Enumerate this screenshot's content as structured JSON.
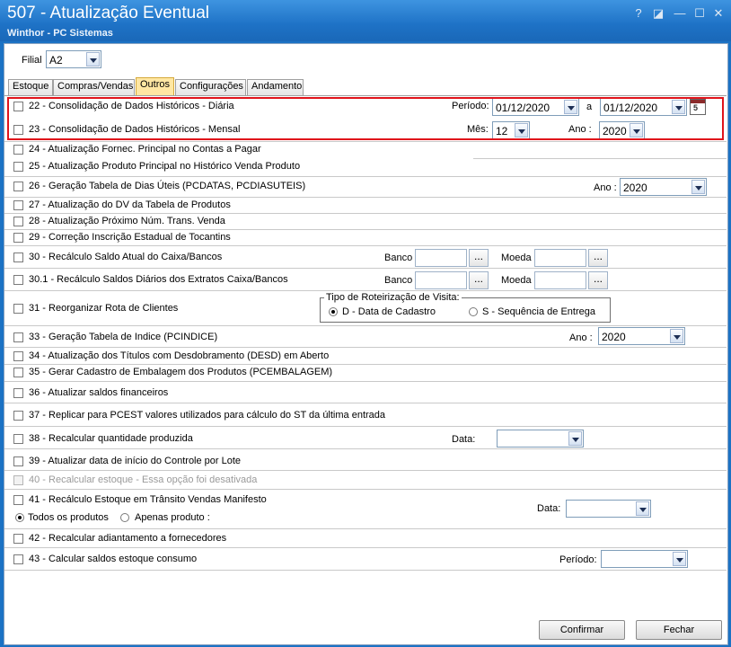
{
  "window": {
    "title": "507 - Atualização Eventual",
    "subtitle": "Winthor - PC Sistemas",
    "help_glyph": "?",
    "restore_glyph": "◪",
    "minimize_glyph": "—",
    "maximize_glyph": "☐",
    "close_glyph": "✕"
  },
  "filial": {
    "label": "Filial",
    "value": "A2"
  },
  "tabs": [
    {
      "label": "Estoque"
    },
    {
      "label": "Compras/Vendas"
    },
    {
      "label": "Outros",
      "active": true
    },
    {
      "label": "Configurações"
    },
    {
      "label": "Andamento"
    }
  ],
  "options": {
    "o22": {
      "label": "22 - Consolidação de Dados Históricos - Diária",
      "periodo_label": "Período:",
      "date_from": "01/12/2020",
      "a_label": "a",
      "date_to": "01/12/2020",
      "cal_digit": "5"
    },
    "o23": {
      "label": "23 - Consolidação de Dados Históricos - Mensal",
      "mes_label": "Mês:",
      "mes_value": "12",
      "ano_label": "Ano :",
      "ano_value": "2020"
    },
    "o24": {
      "label": "24 - Atualização Fornec. Principal no Contas a Pagar"
    },
    "o25": {
      "label": "25 - Atualização Produto Principal no Histórico Venda Produto"
    },
    "o26": {
      "label": "26 - Geração Tabela de Dias Úteis (PCDATAS, PCDIASUTEIS)",
      "ano_label": "Ano :",
      "ano_value": "2020"
    },
    "o27": {
      "label": "27 - Atualização do DV da Tabela de Produtos"
    },
    "o28": {
      "label": "28 - Atualização Próximo Núm. Trans. Venda"
    },
    "o29": {
      "label": "29 - Correção Inscrição Estadual de Tocantins"
    },
    "o30": {
      "label": "30 - Recálculo Saldo Atual do Caixa/Bancos",
      "banco_label": "Banco",
      "moeda_label": "Moeda",
      "dots": "..."
    },
    "o301": {
      "label": "30.1 - Recálculo Saldos Diários dos Extratos Caixa/Bancos",
      "banco_label": "Banco",
      "moeda_label": "Moeda",
      "dots": "..."
    },
    "o31": {
      "label": "31 - Reorganizar Rota de Clientes",
      "group_title": "Tipo de Roteirização de Visita:",
      "radio_d": "D - Data de Cadastro",
      "radio_s": "S - Sequência de Entrega"
    },
    "o33": {
      "label": "33 - Geração Tabela de Indice (PCINDICE)",
      "ano_label": "Ano :",
      "ano_value": "2020"
    },
    "o34": {
      "label": "34 - Atualização dos Títulos com Desdobramento (DESD) em Aberto"
    },
    "o35": {
      "label": "35 - Gerar Cadastro de Embalagem dos Produtos (PCEMBALAGEM)"
    },
    "o36": {
      "label": "36 - Atualizar saldos financeiros"
    },
    "o37": {
      "label": "37 - Replicar para PCEST valores utilizados para cálculo do ST da última entrada"
    },
    "o38": {
      "label": "38 - Recalcular quantidade produzida",
      "data_label": "Data:"
    },
    "o39": {
      "label": "39 - Atualizar data de início do Controle por Lote"
    },
    "o40": {
      "label": "40 - Recalcular estoque - Essa opção foi desativada"
    },
    "o41": {
      "label": "41 - Recálculo Estoque em Trânsito Vendas Manifesto",
      "radio_todos": "Todos os produtos",
      "radio_apenas": "Apenas produto :",
      "data_label": "Data:"
    },
    "o42": {
      "label": "42 - Recalcular adiantamento a fornecedores"
    },
    "o43": {
      "label": "43 - Calcular saldos estoque consumo",
      "periodo_label": "Período:"
    }
  },
  "buttons": {
    "confirmar": "Confirmar",
    "fechar": "Fechar"
  }
}
